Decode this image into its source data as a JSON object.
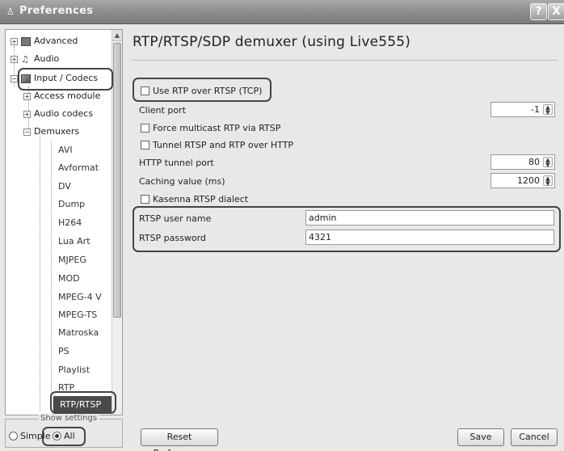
{
  "window": {
    "title": "Preferences",
    "help_glyph": "?",
    "close_glyph": "X"
  },
  "tree": {
    "items": [
      {
        "label": "Advanced",
        "expander": "+",
        "icon": "advanced-icon"
      },
      {
        "label": "Audio",
        "expander": "+",
        "icon": "audio-icon"
      },
      {
        "label": "Input / Codecs",
        "expander": "−",
        "icon": "input-codecs-icon"
      },
      {
        "label": "Access module",
        "expander": "+"
      },
      {
        "label": "Audio codecs",
        "expander": "+"
      },
      {
        "label": "Demuxers",
        "expander": "−"
      }
    ],
    "demuxers": [
      "AVI",
      "Avformat",
      "DV",
      "Dump",
      "H264",
      "Lua Art",
      "MJPEG",
      "MOD",
      "MPEG-4 V",
      "MPEG-TS",
      "Matroska",
      "PS",
      "Playlist",
      "RTP",
      "RTP/RTSP"
    ],
    "selected": "RTP/RTSP"
  },
  "show_settings": {
    "legend": "Show settings",
    "simple": "Simple",
    "all": "All",
    "selected": "All"
  },
  "panel": {
    "title": "RTP/RTSP/SDP demuxer (using Live555)",
    "use_rtp_over_rtsp": {
      "label": "Use RTP over RTSP (TCP)",
      "checked": false
    },
    "client_port": {
      "label": "Client port",
      "value": "-1"
    },
    "force_multicast": {
      "label": "Force multicast RTP via RTSP",
      "checked": false
    },
    "tunnel_http": {
      "label": "Tunnel RTSP and RTP over HTTP",
      "checked": false
    },
    "http_tunnel_port": {
      "label": "HTTP tunnel port",
      "value": "80"
    },
    "caching_value": {
      "label": "Caching value (ms)",
      "value": "1200"
    },
    "kasenna": {
      "label": "Kasenna RTSP dialect",
      "checked": false
    },
    "rtsp_user": {
      "label": "RTSP user name",
      "value": "admin"
    },
    "rtsp_password": {
      "label": "RTSP password",
      "value": "4321"
    }
  },
  "buttons": {
    "reset": "Reset Preferences",
    "save": "Save",
    "cancel": "Cancel"
  }
}
